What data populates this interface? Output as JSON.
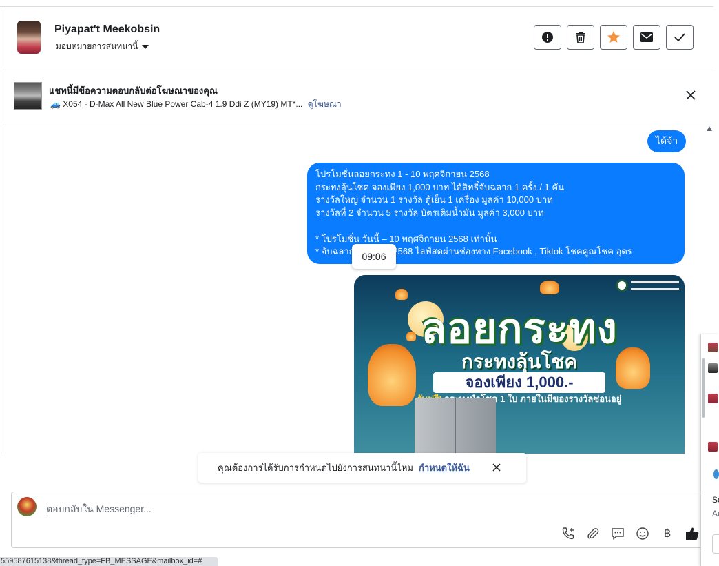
{
  "header": {
    "contact_name": "Piyapat't Meekobsin",
    "assign_label": "มอบหมายการสนทนานี้",
    "actions": [
      {
        "icon": "alert-icon",
        "glyph": "!"
      },
      {
        "icon": "trash-icon",
        "glyph": "🗑"
      },
      {
        "icon": "star-icon",
        "glyph": "★",
        "color": "#f7923a"
      },
      {
        "icon": "mail-icon",
        "glyph": "✉"
      },
      {
        "icon": "check-icon",
        "glyph": "✓"
      }
    ]
  },
  "ad_bar": {
    "title": "แชทนี้มีข้อความตอบกลับต่อโฆษณาของคุณ",
    "ad_name": "🚙 X054 - D-Max All New Blue Power Cab-4 1.9 Ddi Z (MY19) MT*...",
    "view_ad_link": "ดูโฆษณา"
  },
  "messages": {
    "reply_short": "ได้จ้า",
    "promo_lines": [
      "โปรโมชั่นลอยกระทง 1 - 10 พฤศจิกายน 2568",
      "กระทงลุ้นโชค จองเพียง 1,000 บาท ได้สิทธิ์จับฉลาก 1 ครั้ง /  1 คัน",
      "รางวัลใหญ่  จำนวน 1 รางวัล   ตู้เย็น 1  เครื่อง  มูลค่า    10,000  บาท",
      "รางวัลที่ 2  จำนวน 5 รางวัล   บัตรเติมน้ำมัน    มูลค่า    3,000   บาท",
      "",
      "* โปรโมชั่น วันนี้ – 10 พฤศจิกายน 2568 เท่านั้น",
      "* จับฉลาก           ธันวาคม 2568 ไลฟ์สดผ่านช่องทาง Facebook , Tiktok โชคคูณโชค อุดร"
    ],
    "timestamp_tooltip": "09:06",
    "promo_image": {
      "title": "ลอยกระทง",
      "subtitle": "กระทงลุ้นโชค",
      "price_banner": "จองเพียง 1,000.-",
      "free_prefix": "รับฟรี!",
      "free_text": " กระทงนำโชค 1 ใบ ภายในมีของรางวัลซ่อนอยู่"
    }
  },
  "notice": {
    "text": "คุณต้องการได้รับการกำหนดไปยังการสนทนานี้ไหม",
    "assign_link": "กำหนดให้ฉัน"
  },
  "composer": {
    "placeholder": "ตอบกลับใน Messenger...",
    "tools": [
      {
        "icon": "phone-plus-icon",
        "glyph": "✆"
      },
      {
        "icon": "paperclip-icon",
        "glyph": "📎"
      },
      {
        "icon": "saved-reply-icon",
        "glyph": "💬"
      },
      {
        "icon": "emoji-icon",
        "glyph": "☺"
      },
      {
        "icon": "baht-icon",
        "glyph": "฿"
      },
      {
        "icon": "thumbs-up-icon",
        "glyph": "👍"
      }
    ]
  },
  "status_bar": {
    "url": "559587615138&thread_type=FB_MESSAGE&mailbox_id=#"
  },
  "side_panel": {
    "text_1": "So",
    "text_2": "Au"
  },
  "colors": {
    "bubble_blue": "#0a7cff",
    "link_blue": "#385898",
    "star_orange": "#f7923a"
  }
}
